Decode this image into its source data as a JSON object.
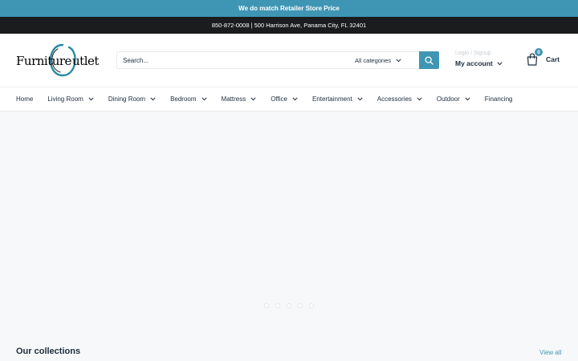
{
  "promo": {
    "text": "We do match Retailer Store Price"
  },
  "info": {
    "text": "850-872-0008 | 500 Harrison Ave, Panama City, FL 32401"
  },
  "logo": {
    "text_left": "Furniture",
    "text_right": "utlet",
    "icon": "o-swoosh-logo"
  },
  "search": {
    "placeholder": "Search...",
    "category_label": "All categories",
    "icon": "search-icon"
  },
  "account": {
    "login_text": "Login / Signup",
    "label": "My account"
  },
  "cart": {
    "count": "0",
    "label": "Cart",
    "icon": "bag-icon"
  },
  "nav": {
    "items": [
      {
        "label": "Home",
        "has_menu": false
      },
      {
        "label": "Living Room",
        "has_menu": true
      },
      {
        "label": "Dining Room",
        "has_menu": true
      },
      {
        "label": "Bedroom",
        "has_menu": true
      },
      {
        "label": "Mattress",
        "has_menu": true
      },
      {
        "label": "Office",
        "has_menu": true
      },
      {
        "label": "Entertainment",
        "has_menu": true
      },
      {
        "label": "Accessories",
        "has_menu": true
      },
      {
        "label": "Outdoor",
        "has_menu": true
      },
      {
        "label": "Financing",
        "has_menu": false
      }
    ]
  },
  "slideshow": {
    "dot_count": 5
  },
  "collections": {
    "title": "Our collections",
    "view_all": "View all"
  },
  "colors": {
    "accent": "#3f96b4",
    "dark_bar": "#1a1c1e",
    "text": "#1e2d3d",
    "page_bg": "#f7f8f9"
  }
}
